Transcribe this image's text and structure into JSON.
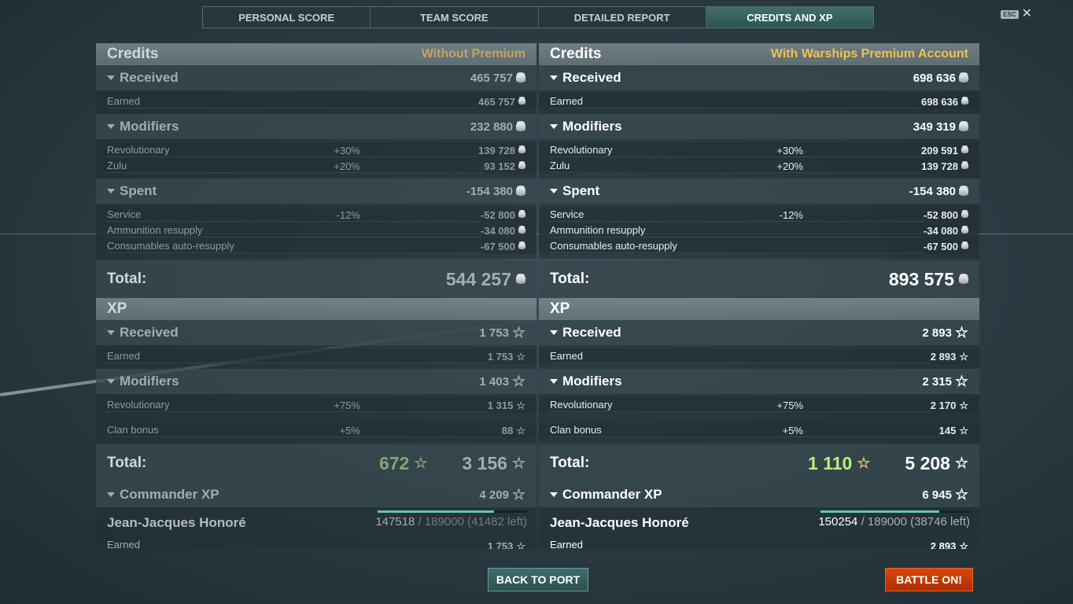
{
  "tabs": [
    "PERSONAL SCORE",
    "TEAM SCORE",
    "DETAILED REPORT",
    "CREDITS AND XP"
  ],
  "esc": {
    "key": "ESC",
    "close": "✕"
  },
  "left": {
    "credits_title": "Credits",
    "account": "Without Premium",
    "received": {
      "label": "Received",
      "value": "465 757"
    },
    "earned": {
      "label": "Earned",
      "value": "465 757"
    },
    "modifiers": {
      "label": "Modifiers",
      "value": "232 880"
    },
    "mod_rows": [
      {
        "label": "Revolutionary",
        "pct": "+30%",
        "value": "139 728"
      },
      {
        "label": "Zulu",
        "pct": "+20%",
        "value": "93 152"
      }
    ],
    "spent": {
      "label": "Spent",
      "value": "-154 380"
    },
    "spent_rows": [
      {
        "label": "Service",
        "pct": "-12%",
        "value": "-52 800"
      },
      {
        "label": "Ammunition resupply",
        "pct": "",
        "value": "-34 080"
      },
      {
        "label": "Consumables auto-resupply",
        "pct": "",
        "value": "-67 500"
      }
    ],
    "credits_total": {
      "label": "Total:",
      "value": "544 257"
    },
    "xp_title": "XP",
    "xp_received": {
      "label": "Received",
      "value": "1 753"
    },
    "xp_earned": {
      "label": "Earned",
      "value": "1 753"
    },
    "xp_modifiers": {
      "label": "Modifiers",
      "value": "1 403"
    },
    "xp_mod_rows": [
      {
        "label": "Revolutionary",
        "pct": "+75%",
        "value": "1 315"
      },
      {
        "label": "Clan bonus",
        "pct": "+5%",
        "value": "88"
      }
    ],
    "xp_total": {
      "label": "Total:",
      "free": "672",
      "value": "3 156"
    },
    "commander": {
      "label": "Commander XP",
      "value": "4 209",
      "name": "Jean-Jacques Honoré",
      "current": "147518",
      "progress_rest": "/ 189000 (41482 left)",
      "progress_fraction": 0.78,
      "earned_label": "Earned",
      "earned_value": "1 753"
    }
  },
  "right": {
    "credits_title": "Credits",
    "account": "With Warships Premium Account",
    "received": {
      "label": "Received",
      "value": "698 636"
    },
    "earned": {
      "label": "Earned",
      "value": "698 636"
    },
    "modifiers": {
      "label": "Modifiers",
      "value": "349 319"
    },
    "mod_rows": [
      {
        "label": "Revolutionary",
        "pct": "+30%",
        "value": "209 591"
      },
      {
        "label": "Zulu",
        "pct": "+20%",
        "value": "139 728"
      }
    ],
    "spent": {
      "label": "Spent",
      "value": "-154 380"
    },
    "spent_rows": [
      {
        "label": "Service",
        "pct": "-12%",
        "value": "-52 800"
      },
      {
        "label": "Ammunition resupply",
        "pct": "",
        "value": "-34 080"
      },
      {
        "label": "Consumables auto-resupply",
        "pct": "",
        "value": "-67 500"
      }
    ],
    "credits_total": {
      "label": "Total:",
      "value": "893 575"
    },
    "xp_title": "XP",
    "xp_received": {
      "label": "Received",
      "value": "2 893"
    },
    "xp_earned": {
      "label": "Earned",
      "value": "2 893"
    },
    "xp_modifiers": {
      "label": "Modifiers",
      "value": "2 315"
    },
    "xp_mod_rows": [
      {
        "label": "Revolutionary",
        "pct": "+75%",
        "value": "2 170"
      },
      {
        "label": "Clan bonus",
        "pct": "+5%",
        "value": "145"
      }
    ],
    "xp_total": {
      "label": "Total:",
      "free": "1 110",
      "value": "5 208"
    },
    "commander": {
      "label": "Commander XP",
      "value": "6 945",
      "name": "Jean-Jacques Honoré",
      "current": "150254",
      "progress_rest": "/ 189000 (38746 left)",
      "progress_fraction": 0.795,
      "earned_label": "Earned",
      "earned_value": "2 893"
    }
  },
  "buttons": {
    "back": "BACK TO PORT",
    "battle": "BATTLE ON!"
  },
  "colors": {
    "accent_tab": "#3f6e6b",
    "battle_button": "#d8460b",
    "premium_gold": "#f1c14b",
    "free_xp_green": "#b9f07c"
  }
}
